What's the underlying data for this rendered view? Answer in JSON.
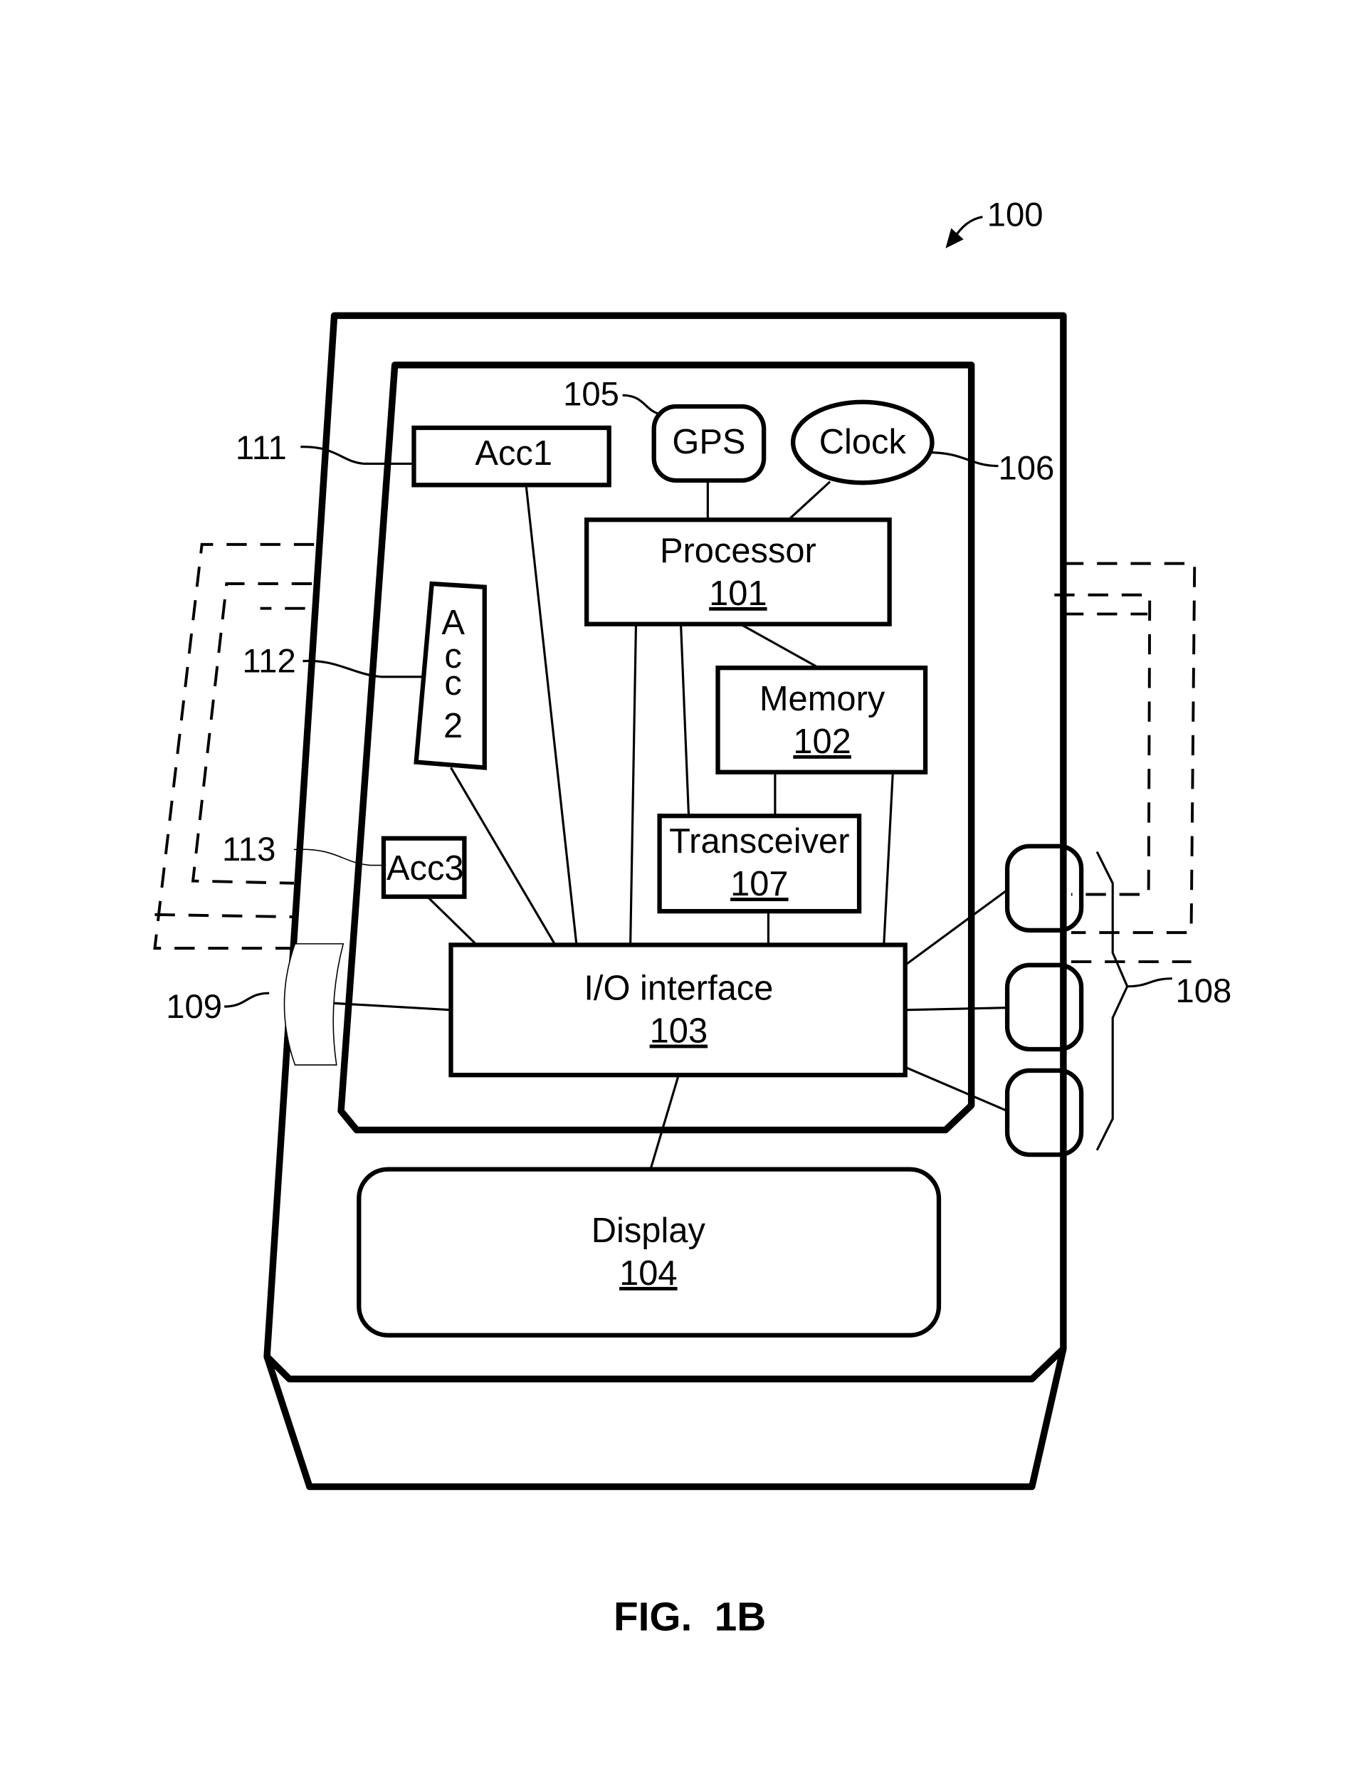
{
  "figure": {
    "caption": "FIG.  1B",
    "device_ref": "100"
  },
  "components": {
    "processor": {
      "name": "Processor",
      "ref": "101"
    },
    "memory": {
      "name": "Memory",
      "ref": "102"
    },
    "io": {
      "name": "I/O interface",
      "ref": "103"
    },
    "display": {
      "name": "Display",
      "ref": "104"
    },
    "gps": {
      "name": "GPS",
      "ref": "105"
    },
    "clock": {
      "name": "Clock",
      "ref": "106"
    },
    "transceiver": {
      "name": "Transceiver",
      "ref": "107"
    },
    "buttons": {
      "ref": "108"
    },
    "connector": {
      "ref": "109"
    },
    "acc1": {
      "name": "Acc1",
      "ref": "111"
    },
    "acc2": {
      "name_chars": [
        "A",
        "c",
        "c",
        "2"
      ],
      "ref": "112"
    },
    "acc3": {
      "name": "Acc3",
      "ref": "113"
    }
  }
}
